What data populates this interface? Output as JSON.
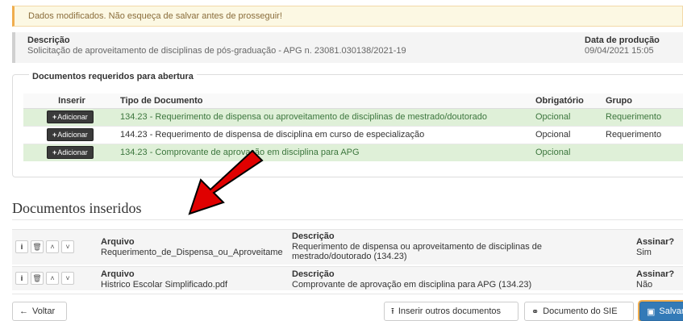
{
  "alert": {
    "text": "Dados modificados. Não esqueça de salvar antes de prosseguir!"
  },
  "process": {
    "desc_label": "Descrição",
    "desc_value": "Solicitação de aproveitamento de disciplinas de pós-graduação - APG n. 23081.030138/2021-19",
    "date_label": "Data de produção",
    "date_value": "09/04/2021 15:05"
  },
  "required_docs": {
    "legend": "Documentos requeridos para abertura",
    "headers": {
      "insert": "Inserir",
      "type": "Tipo de Documento",
      "mandatory": "Obrigatório",
      "group": "Grupo"
    },
    "add_label": "Adicionar",
    "rows": [
      {
        "type": "134.23 - Requerimento de dispensa ou aproveitamento de disciplinas de mestrado/doutorado",
        "mandatory": "Opcional",
        "group": "Requerimento",
        "status": "inserted"
      },
      {
        "type": "144.23 - Requerimento de dispensa de disciplina em curso de especialização",
        "mandatory": "Opcional",
        "group": "Requerimento",
        "status": "pending"
      },
      {
        "type": "134.23 - Comprovante de aprovação em disciplina para APG",
        "mandatory": "Opcional",
        "group": "",
        "status": "inserted"
      }
    ]
  },
  "inserted_docs": {
    "title": "Documentos inseridos",
    "file_label": "Arquivo",
    "desc_label": "Descrição",
    "sign_label": "Assinar?",
    "rows": [
      {
        "file": "Requerimento_de_Dispensa_ou_Aproveitame",
        "description": "Requerimento de dispensa ou aproveitamento de disciplinas de mestrado/doutorado (134.23)",
        "sign": "Sim"
      },
      {
        "file": "Histrico Escolar Simplificado.pdf",
        "description": "Comprovante de aprovação em disciplina para APG (134.23)",
        "sign": "Não"
      }
    ]
  },
  "footer": {
    "back_label": "Voltar",
    "insert_other_label": "Inserir outros documentos",
    "sie_doc_label": "Documento do SIE",
    "save_label": "Salvar"
  },
  "colors": {
    "alert_bg": "#fcf8e3",
    "alert_border": "#f0ad4e",
    "success_row": "#dff0d8",
    "success_text": "#3c763d",
    "primary": "#337ab7",
    "annotation_arrow": "#e00000"
  }
}
